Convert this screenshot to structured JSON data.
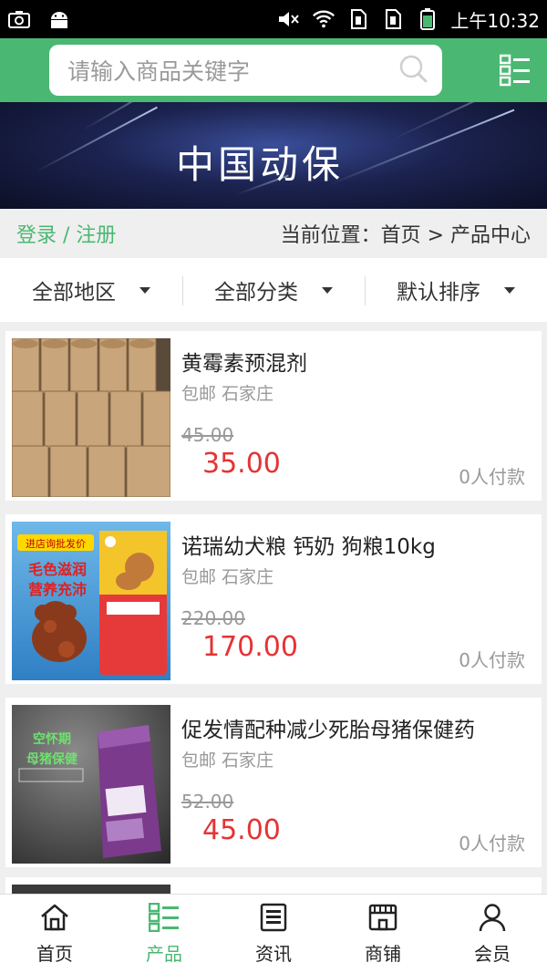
{
  "status_bar": {
    "time": "上午10:32"
  },
  "header": {
    "search_placeholder": "请输入商品关键字"
  },
  "banner": {
    "title": "中国动保"
  },
  "breadcrumb": {
    "login_text": "登录 / 注册",
    "location_text": "当前位置：首页 > 产品中心"
  },
  "filters": [
    {
      "label": "全部地区"
    },
    {
      "label": "全部分类"
    },
    {
      "label": "默认排序"
    }
  ],
  "products": [
    {
      "name": "黄霉素预混剂",
      "meta": "包邮 石家庄",
      "old_price": "45.00",
      "price": "35.00",
      "buyers": "0人付款"
    },
    {
      "name": "诺瑞幼犬粮 钙奶 狗粮10kg",
      "meta": "包邮 石家庄",
      "old_price": "220.00",
      "price": "170.00",
      "buyers": "0人付款",
      "image_text": {
        "badge": "进店询批发价",
        "line1": "毛色滋润",
        "line2": "营养充沛"
      }
    },
    {
      "name": "促发情配种减少死胎母猪保健药",
      "meta": "包邮 石家庄",
      "old_price": "52.00",
      "price": "45.00",
      "buyers": "0人付款",
      "image_text": {
        "line1": "空怀期",
        "line2": "母猪保健"
      }
    }
  ],
  "tabbar": [
    {
      "label": "首页",
      "icon": "home-icon",
      "active": false
    },
    {
      "label": "产品",
      "icon": "list-icon",
      "active": true
    },
    {
      "label": "资讯",
      "icon": "news-icon",
      "active": false
    },
    {
      "label": "商铺",
      "icon": "shop-icon",
      "active": false
    },
    {
      "label": "会员",
      "icon": "user-icon",
      "active": false
    }
  ],
  "colors": {
    "brand_green": "#4ab872",
    "price_red": "#e53333",
    "banner_dark": "#0b0f25"
  }
}
